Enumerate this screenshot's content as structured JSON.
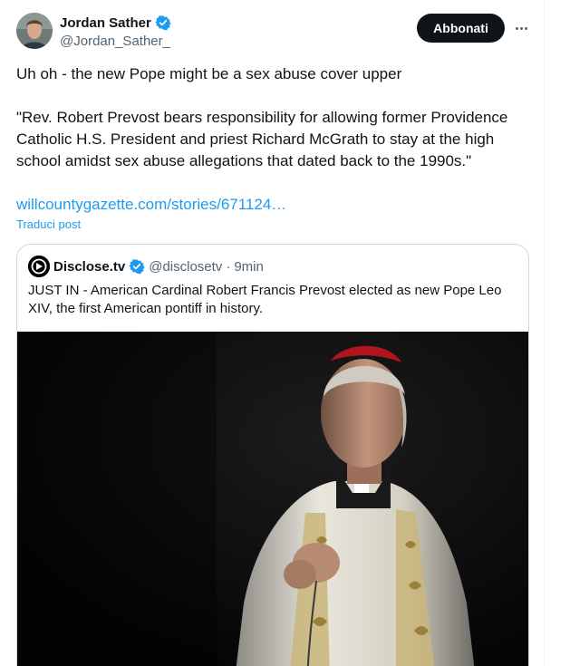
{
  "author": {
    "name": "Jordan Sather",
    "handle": "@Jordan_Sather_",
    "verified": true
  },
  "actions": {
    "subscribe_label": "Abbonati",
    "more_icon": "more-horizontal-icon"
  },
  "post": {
    "line1": "Uh oh - the new Pope might be a sex abuse cover upper",
    "line2": "\"Rev. Robert Prevost bears responsibility for allowing former Providence Catholic H.S. President and priest Richard McGrath to stay at the high school amidst sex abuse allegations that dated back to the 1990s.\"",
    "link": "willcountygazette.com/stories/671124…",
    "translate_label": "Traduci post"
  },
  "quote": {
    "name": "Disclose.tv",
    "handle": "@disclosetv",
    "separator": "·",
    "time": "9min",
    "text": "JUST IN - American Cardinal Robert Francis Prevost elected as new Pope Leo XIV, the first American pontiff in history."
  },
  "colors": {
    "accent": "#1d9bf0",
    "text": "#0f1419",
    "muted": "#536471",
    "border": "#cfd9de",
    "button_bg": "#0f1419",
    "zucchetto_red": "#b0141e"
  }
}
